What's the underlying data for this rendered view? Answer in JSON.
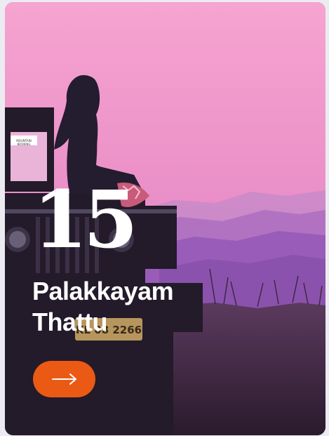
{
  "card": {
    "number": "15",
    "title_line1": "Palakkayam",
    "title_line2": "Thattu",
    "image": {
      "plate_text": "KL 08 2266",
      "sticker_line1": "MOUNTAIN",
      "sticker_line2": "BOOKING"
    },
    "cta_icon": "arrow-right-icon"
  },
  "colors": {
    "sky_top": "#f3a3cf",
    "sky_mid": "#e58cc6",
    "mountains": "#9a5cb9",
    "accent_button": "#ea5a14",
    "text": "#ffffff"
  }
}
